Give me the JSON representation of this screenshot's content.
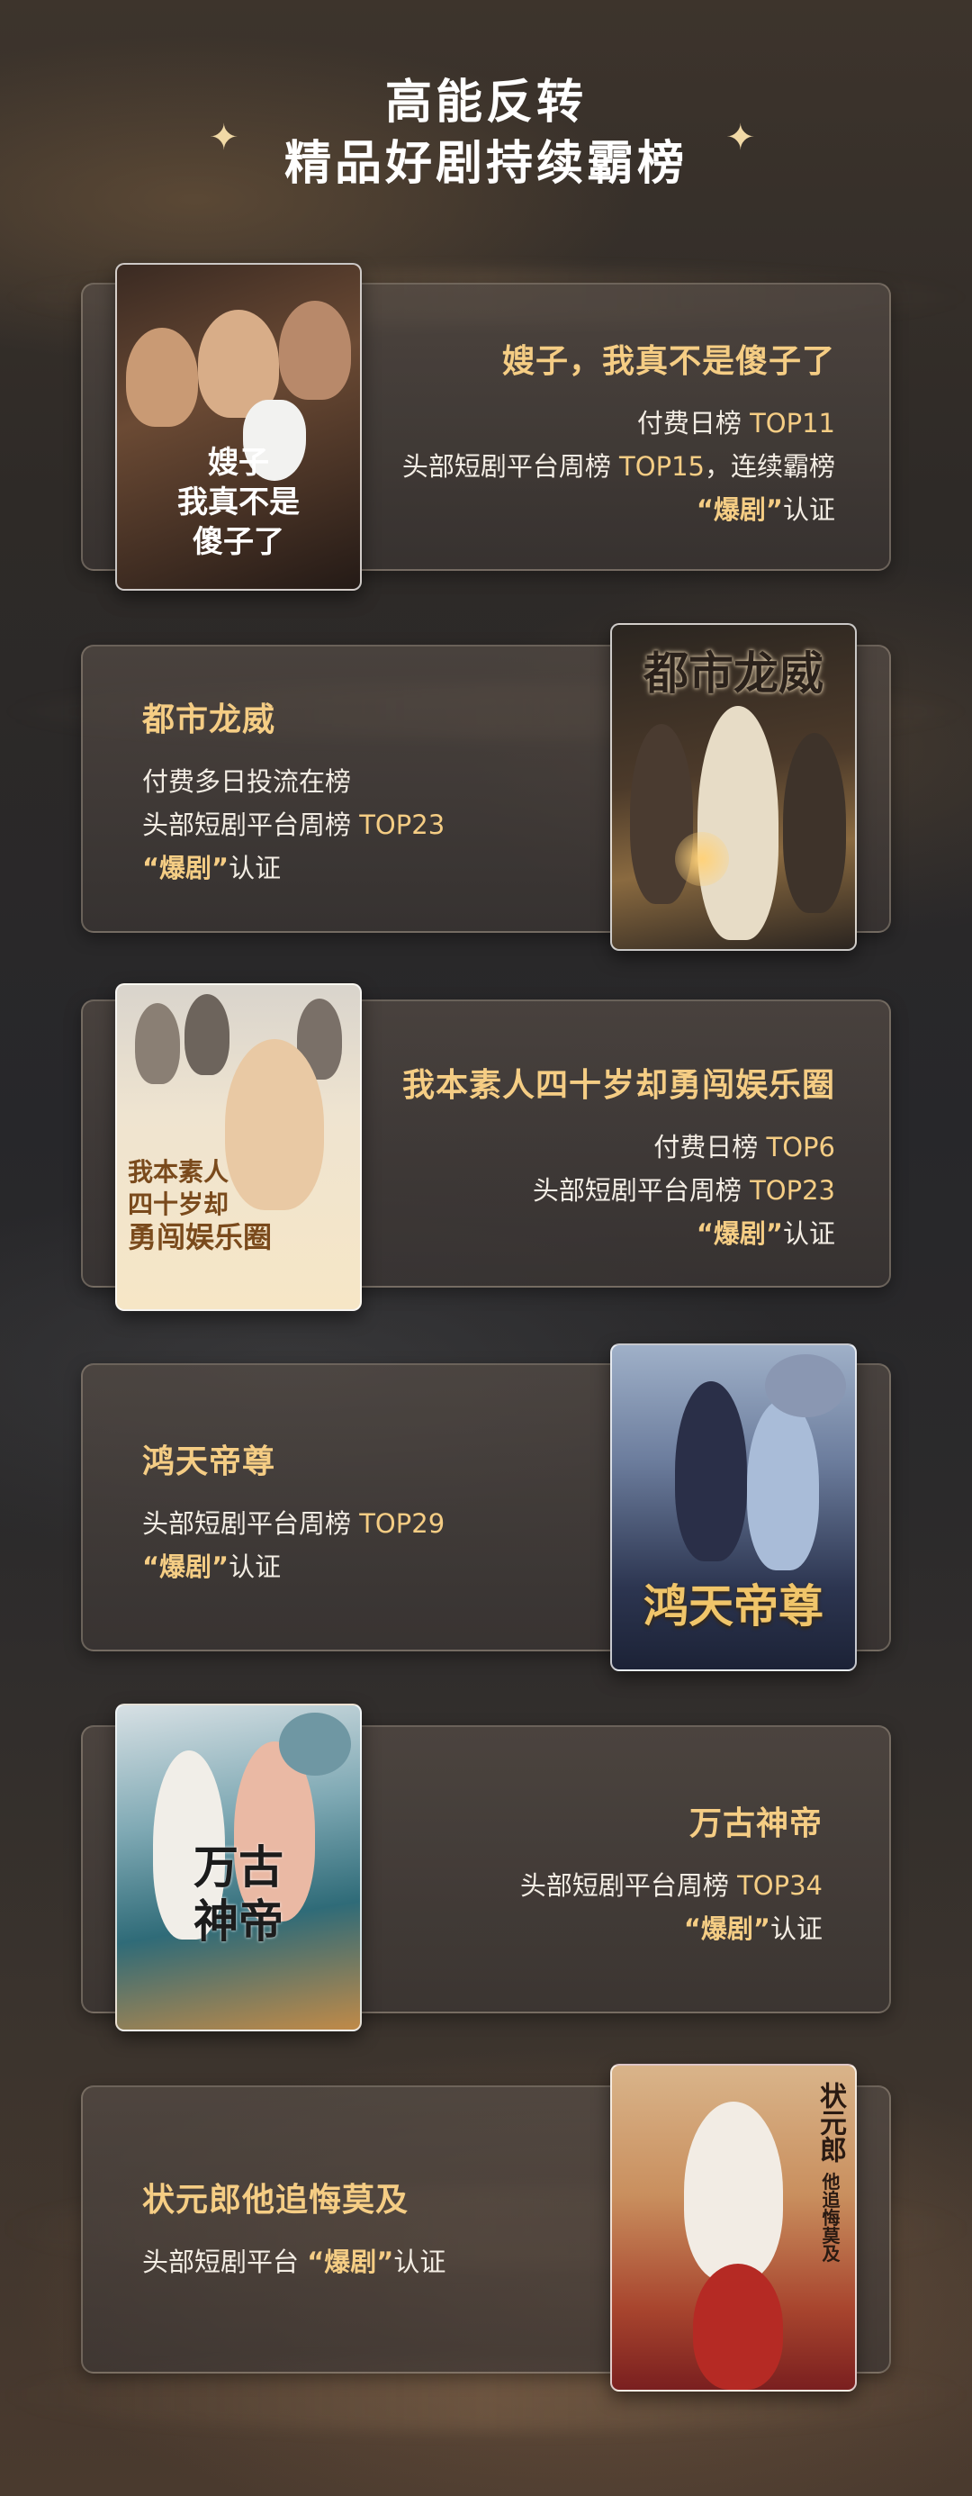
{
  "header": {
    "line1": "高能反转",
    "line2": "精品好剧持续霸榜"
  },
  "dramas": [
    {
      "title": "嫂子，我真不是傻子了",
      "poster_text": [
        "嫂子",
        "我真不是",
        "傻子了"
      ],
      "lines": [
        {
          "text": "付费日榜 ",
          "highlight": "TOP11",
          "suffix": ""
        },
        {
          "text": "头部短剧平台周榜 ",
          "highlight": "TOP15",
          "suffix": "，连续霸榜"
        }
      ],
      "cert_hl": "“爆剧”",
      "cert_text": "认证"
    },
    {
      "title": "都市龙威",
      "poster_text": [
        "都市龙威"
      ],
      "lines": [
        {
          "text": "付费多日投流在榜",
          "highlight": "",
          "suffix": ""
        },
        {
          "text": "头部短剧平台周榜 ",
          "highlight": "TOP23",
          "suffix": ""
        }
      ],
      "cert_hl": "“爆剧”",
      "cert_text": "认证"
    },
    {
      "title": "我本素人四十岁却勇闯娱乐圈",
      "poster_text": [
        "我本素人",
        "四十岁却",
        "勇闯娱乐圈"
      ],
      "lines": [
        {
          "text": "付费日榜 ",
          "highlight": "TOP6",
          "suffix": ""
        },
        {
          "text": "头部短剧平台周榜 ",
          "highlight": "TOP23",
          "suffix": ""
        }
      ],
      "cert_hl": "“爆剧”",
      "cert_text": "认证"
    },
    {
      "title": "鸿天帝尊",
      "poster_text": [
        "鸿天帝尊"
      ],
      "lines": [
        {
          "text": "头部短剧平台周榜 ",
          "highlight": "TOP29",
          "suffix": ""
        }
      ],
      "cert_hl": "“爆剧”",
      "cert_text": "认证"
    },
    {
      "title": "万古神帝",
      "poster_text": [
        "万古",
        "神帝"
      ],
      "lines": [
        {
          "text": "头部短剧平台周榜 ",
          "highlight": "TOP34",
          "suffix": ""
        }
      ],
      "cert_hl": "“爆剧”",
      "cert_text": "认证"
    },
    {
      "title": "状元郎他追悔莫及",
      "poster_text": [
        "状元郎",
        "他追悔莫及"
      ],
      "lines": [],
      "cert_prefix": "头部短剧平台 ",
      "cert_hl": "“爆剧”",
      "cert_text": "认证"
    }
  ],
  "colors": {
    "accent": "#f5cd84",
    "text": "#f3ede4",
    "title": "#ffffff"
  }
}
